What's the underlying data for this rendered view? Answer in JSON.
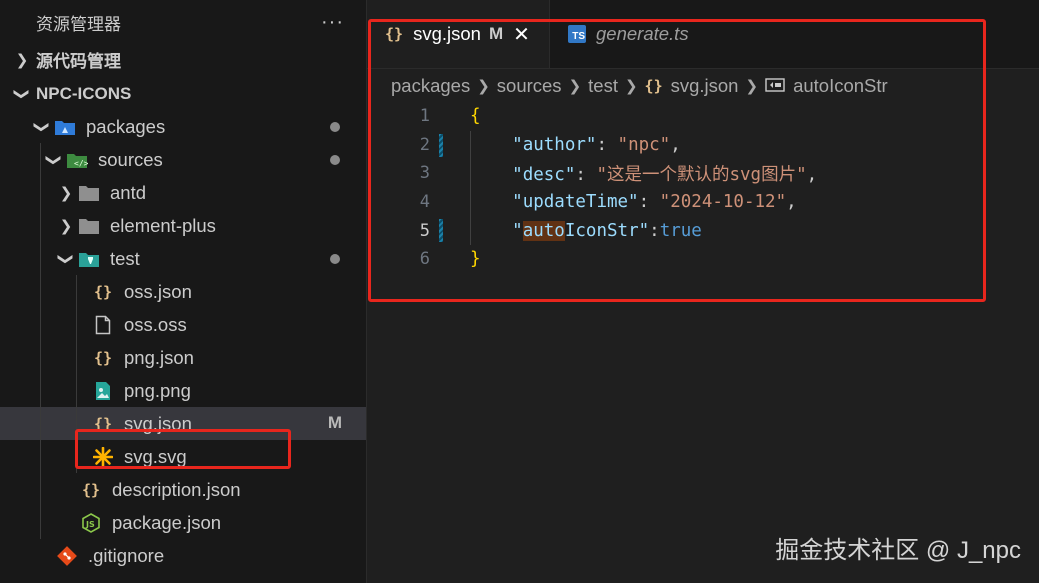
{
  "explorer": {
    "title": "资源管理器",
    "more": "···",
    "source_control": "源代码管理",
    "project": "NPC-ICONS"
  },
  "tree": [
    {
      "name": "packages",
      "icon": "folder-icon",
      "open": true,
      "badge": "dot"
    },
    {
      "name": "sources",
      "icon": "folder-icon",
      "open": true,
      "badge": "dot"
    },
    {
      "name": "antd",
      "icon": "folder-icon",
      "open": false
    },
    {
      "name": "element-plus",
      "icon": "folder-icon",
      "open": false
    },
    {
      "name": "test",
      "icon": "folder-icon",
      "open": true,
      "badge": "dot"
    },
    {
      "name": "oss.json",
      "icon": "json-icon"
    },
    {
      "name": "oss.oss",
      "icon": "file-icon"
    },
    {
      "name": "png.json",
      "icon": "json-icon"
    },
    {
      "name": "png.png",
      "icon": "image-icon"
    },
    {
      "name": "svg.json",
      "icon": "json-icon",
      "selected": true,
      "badge": "M"
    },
    {
      "name": "svg.svg",
      "icon": "svg-icon"
    },
    {
      "name": "description.json",
      "icon": "json-icon"
    },
    {
      "name": "package.json",
      "icon": "nodejs-icon"
    },
    {
      "name": ".gitignore",
      "icon": "git-icon"
    }
  ],
  "tabs": [
    {
      "label": "svg.json",
      "modified": "M",
      "active": true
    },
    {
      "label": "generate.ts",
      "active": false
    }
  ],
  "breadcrumb": {
    "p1": "packages",
    "p2": "sources",
    "p3": "test",
    "p4": "svg.json",
    "p5": "autoIconStr"
  },
  "code": {
    "line_numbers": [
      "1",
      "2",
      "3",
      "4",
      "5",
      "6"
    ],
    "open_brace": "{",
    "close_brace": "}",
    "author_key": "\"author\"",
    "author_val": "\"npc\"",
    "desc_key": "\"desc\"",
    "desc_val": "\"这是一个默认的svg图片\"",
    "update_key": "\"updateTime\"",
    "update_val": "\"2024-10-12\"",
    "auto_q1": "\"",
    "auto_hl": "auto",
    "auto_rest": "IconStr\"",
    "auto_val": "true"
  },
  "watermark": "掘金技术社区 @ J_npc",
  "colors": {
    "accent_red": "#e8261d",
    "key": "#9cdcfe",
    "string": "#ce9178",
    "boolean": "#569cd6",
    "json_icon": "#e2c08d"
  }
}
